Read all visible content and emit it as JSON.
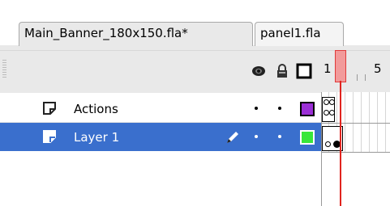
{
  "tabs": [
    {
      "label": "Main_Banner_180x150.fla*",
      "active": true
    },
    {
      "label": "panel1.fla",
      "active": false
    }
  ],
  "header": {
    "icons": [
      "eye-icon",
      "lock-icon",
      "outline-icon"
    ],
    "frame_numbers": [
      "1",
      "5"
    ]
  },
  "layers": [
    {
      "name": "Actions",
      "selected": false,
      "swatch_color": "#9b2fd6",
      "pencil": false
    },
    {
      "name": "Layer 1",
      "selected": true,
      "swatch_color": "#39e639",
      "pencil": true
    }
  ],
  "colors": {
    "selection": "#3a6fcd",
    "playhead": "#e0241f"
  }
}
